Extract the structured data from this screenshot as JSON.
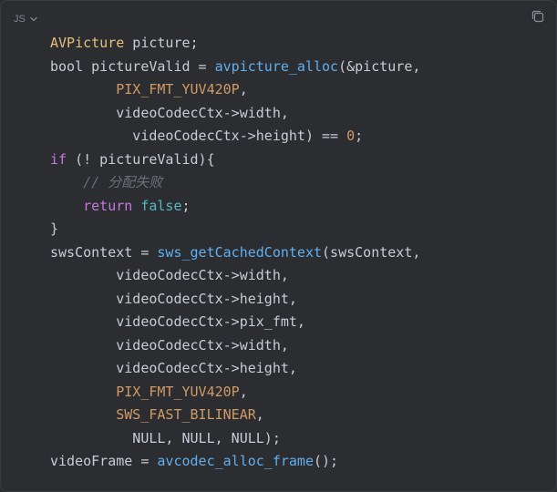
{
  "header": {
    "language": "JS"
  },
  "colors": {
    "background": "#2b2d31",
    "plain": "#c8ccd4",
    "type": "#e5c07b",
    "function": "#61afef",
    "constant": "#d19a66",
    "keyword": "#c678dd",
    "boolean": "#56b6c2",
    "comment": "#6b7079"
  },
  "icons": {
    "language_dropdown": "chevron-down-icon",
    "copy": "copy-icon"
  },
  "code_lines": [
    [
      {
        "t": "type",
        "v": "AVPicture"
      },
      {
        "t": "plain",
        "v": " picture;"
      }
    ],
    [
      {
        "t": "plain",
        "v": "bool pictureValid = "
      },
      {
        "t": "fn",
        "v": "avpicture_alloc"
      },
      {
        "t": "plain",
        "v": "(&picture,"
      }
    ],
    [
      {
        "t": "plain",
        "v": "        "
      },
      {
        "t": "const",
        "v": "PIX_FMT_YUV420P"
      },
      {
        "t": "plain",
        "v": ","
      }
    ],
    [
      {
        "t": "plain",
        "v": "        videoCodecCtx->width,"
      }
    ],
    [
      {
        "t": "plain",
        "v": "          videoCodecCtx->height) == "
      },
      {
        "t": "num",
        "v": "0"
      },
      {
        "t": "plain",
        "v": ";"
      }
    ],
    [
      {
        "t": "kw",
        "v": "if"
      },
      {
        "t": "plain",
        "v": " (! pictureValid){"
      }
    ],
    [
      {
        "t": "plain",
        "v": "    "
      },
      {
        "t": "comment",
        "v": "// 分配失败"
      }
    ],
    [
      {
        "t": "plain",
        "v": "    "
      },
      {
        "t": "kw",
        "v": "return"
      },
      {
        "t": "plain",
        "v": " "
      },
      {
        "t": "bool",
        "v": "false"
      },
      {
        "t": "plain",
        "v": ";"
      }
    ],
    [
      {
        "t": "plain",
        "v": "}"
      }
    ],
    [
      {
        "t": "plain",
        "v": "swsContext = "
      },
      {
        "t": "fn",
        "v": "sws_getCachedContext"
      },
      {
        "t": "plain",
        "v": "(swsContext,"
      }
    ],
    [
      {
        "t": "plain",
        "v": "        videoCodecCtx->width,"
      }
    ],
    [
      {
        "t": "plain",
        "v": "        videoCodecCtx->height,"
      }
    ],
    [
      {
        "t": "plain",
        "v": "        videoCodecCtx->pix_fmt,"
      }
    ],
    [
      {
        "t": "plain",
        "v": "        videoCodecCtx->width,"
      }
    ],
    [
      {
        "t": "plain",
        "v": "        videoCodecCtx->height,"
      }
    ],
    [
      {
        "t": "plain",
        "v": "        "
      },
      {
        "t": "const",
        "v": "PIX_FMT_YUV420P"
      },
      {
        "t": "plain",
        "v": ","
      }
    ],
    [
      {
        "t": "plain",
        "v": "        "
      },
      {
        "t": "const",
        "v": "SWS_FAST_BILINEAR"
      },
      {
        "t": "plain",
        "v": ","
      }
    ],
    [
      {
        "t": "plain",
        "v": "          NULL, NULL, NULL);"
      }
    ],
    [
      {
        "t": "plain",
        "v": "videoFrame = "
      },
      {
        "t": "fn",
        "v": "avcodec_alloc_frame"
      },
      {
        "t": "plain",
        "v": "();"
      }
    ]
  ]
}
